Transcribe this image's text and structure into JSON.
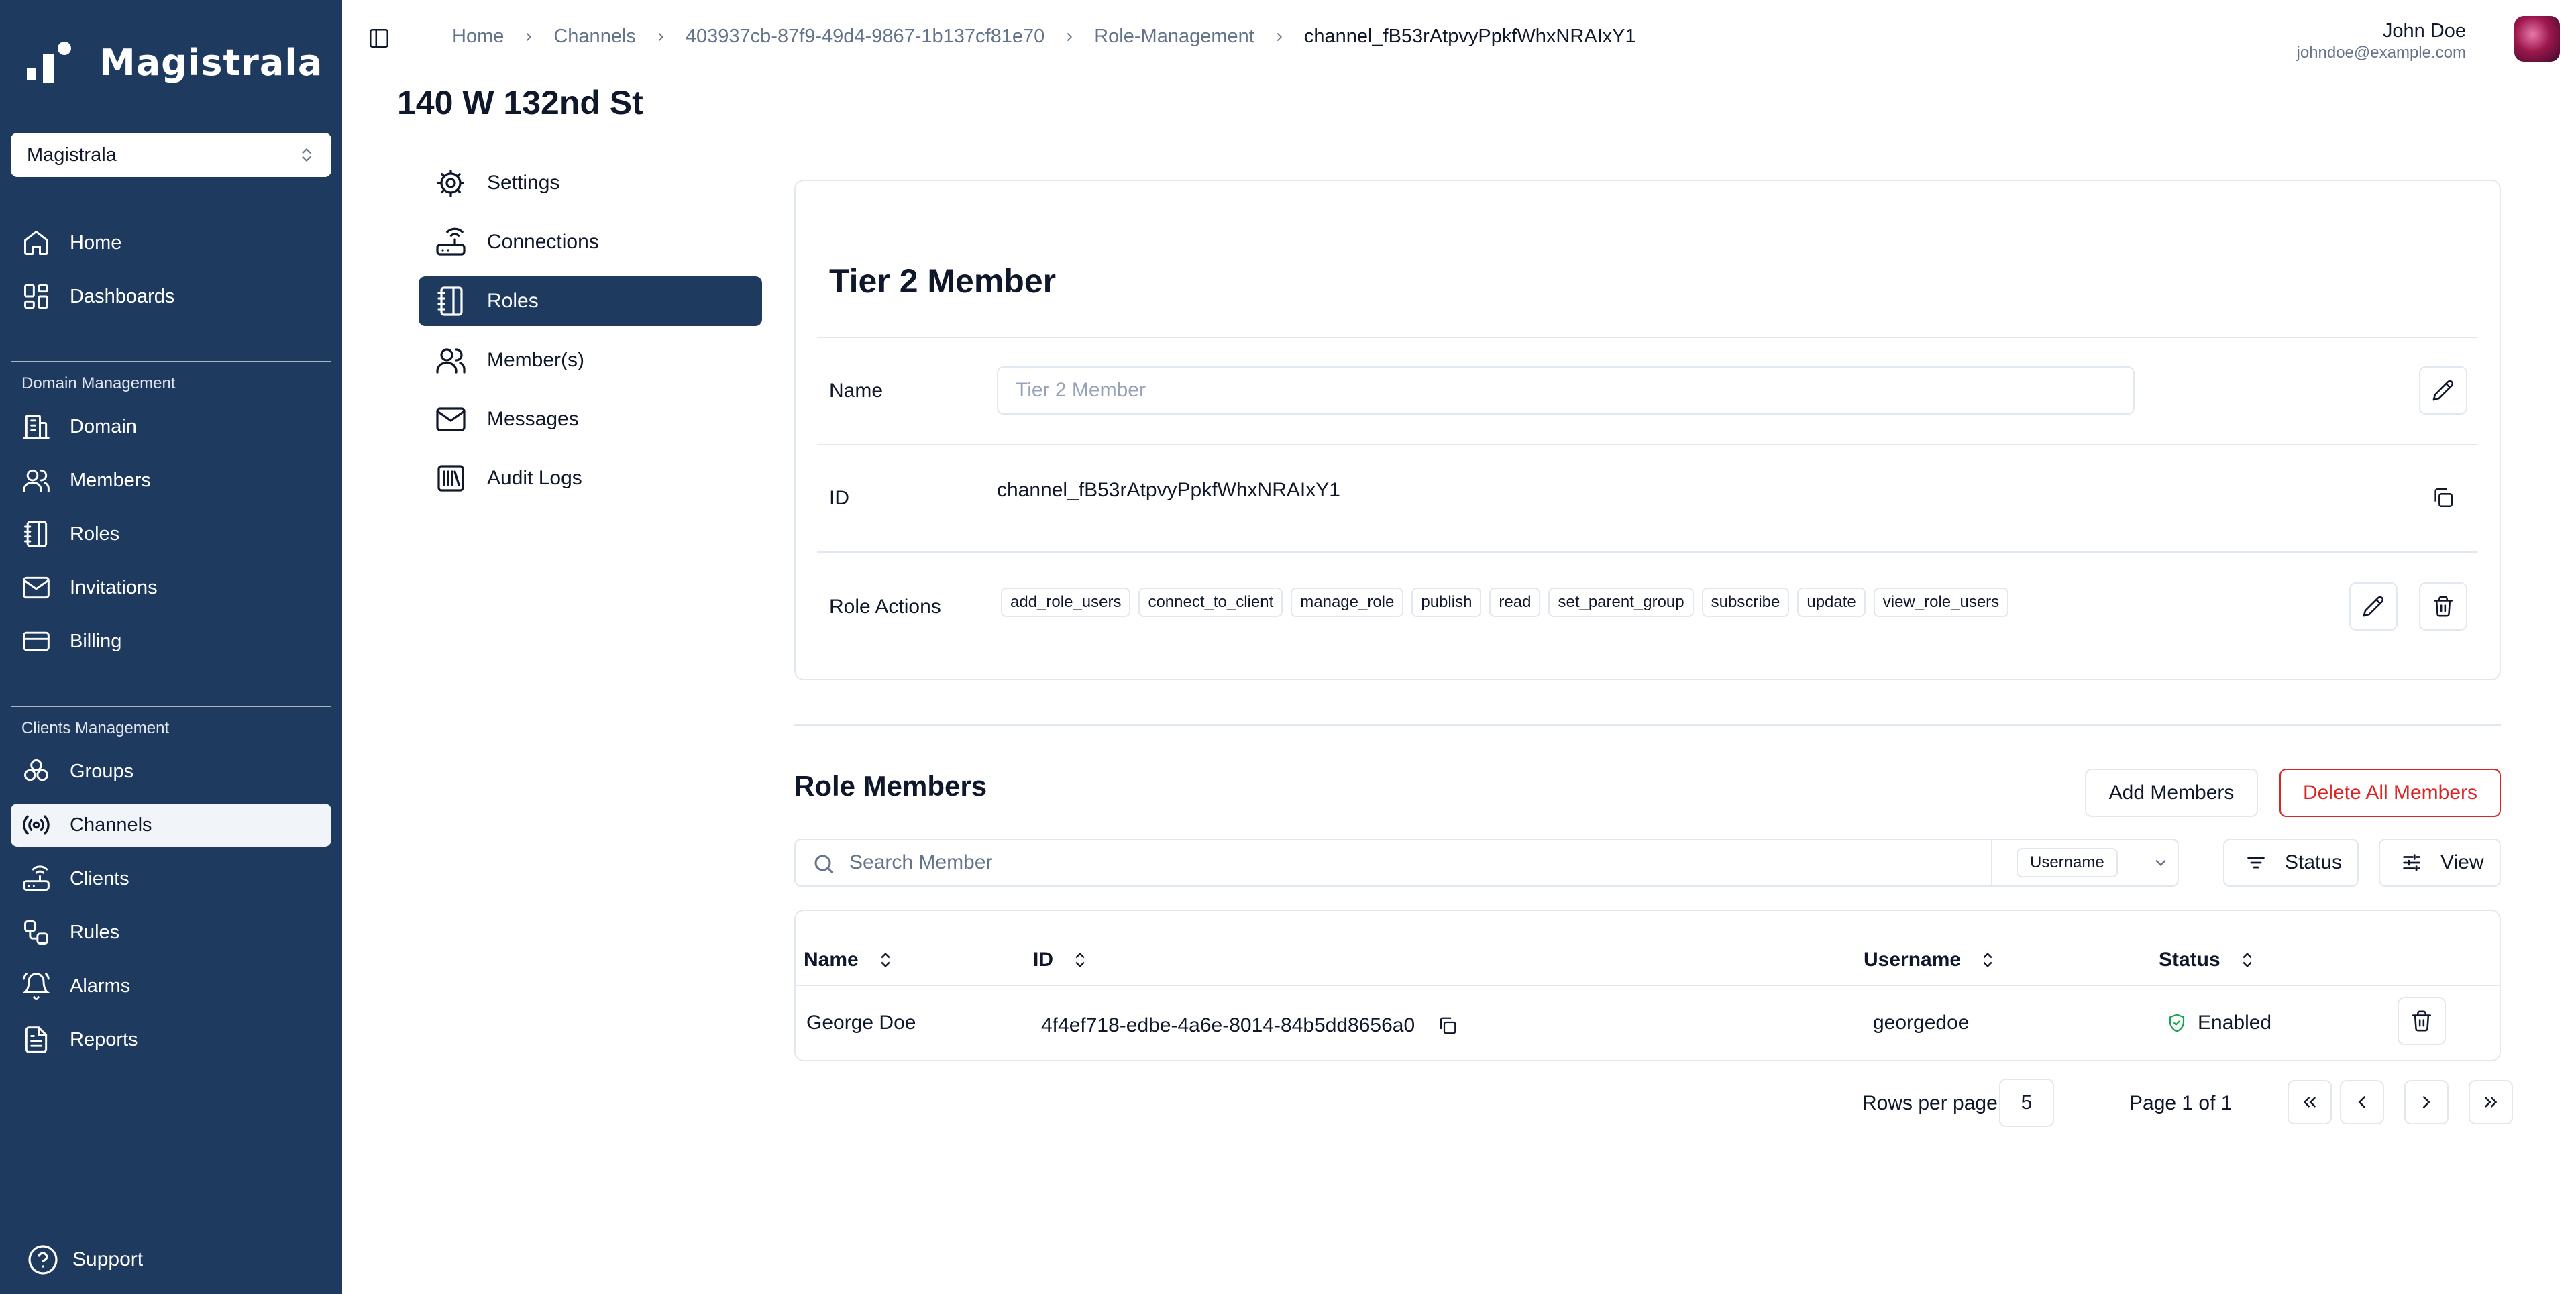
{
  "sidebar": {
    "brand": "Magistrala",
    "org_select": "Magistrala",
    "primary": [
      {
        "label": "Home",
        "icon": "home-icon"
      },
      {
        "label": "Dashboards",
        "icon": "dashboard-icon"
      }
    ],
    "domain_section": "Domain Management",
    "domain_items": [
      {
        "label": "Domain",
        "icon": "building-icon"
      },
      {
        "label": "Members",
        "icon": "users-icon"
      },
      {
        "label": "Roles",
        "icon": "notebook-icon"
      },
      {
        "label": "Invitations",
        "icon": "mail-icon"
      },
      {
        "label": "Billing",
        "icon": "credit-card-icon"
      }
    ],
    "clients_section": "Clients Management",
    "clients_items": [
      {
        "label": "Groups",
        "icon": "groups-icon"
      },
      {
        "label": "Channels",
        "icon": "radio-icon",
        "active": true
      },
      {
        "label": "Clients",
        "icon": "router-icon"
      },
      {
        "label": "Rules",
        "icon": "workflow-icon"
      },
      {
        "label": "Alarms",
        "icon": "bell-icon"
      },
      {
        "label": "Reports",
        "icon": "report-icon"
      }
    ],
    "support": "Support"
  },
  "breadcrumb": [
    "Home",
    "Channels",
    "403937cb-87f9-49d4-9867-1b137cf81e70",
    "Role-Management",
    "channel_fB53rAtpvyPpkfWhxNRAIxY1"
  ],
  "user": {
    "name": "John Doe",
    "email": "johndoe@example.com"
  },
  "page_title": "140 W 132nd St",
  "subnav": [
    {
      "label": "Settings",
      "icon": "settings-icon"
    },
    {
      "label": "Connections",
      "icon": "router-icon"
    },
    {
      "label": "Roles",
      "icon": "notebook-icon",
      "active": true
    },
    {
      "label": "Member(s)",
      "icon": "users-icon"
    },
    {
      "label": "Messages",
      "icon": "mail-icon"
    },
    {
      "label": "Audit Logs",
      "icon": "library-icon"
    }
  ],
  "role": {
    "title": "Tier 2 Member",
    "name_label": "Name",
    "name_value": "Tier 2 Member",
    "id_label": "ID",
    "id_value": "channel_fB53rAtpvyPpkfWhxNRAIxY1",
    "actions_label": "Role Actions",
    "actions": [
      "add_role_users",
      "connect_to_client",
      "manage_role",
      "publish",
      "read",
      "set_parent_group",
      "subscribe",
      "update",
      "view_role_users"
    ]
  },
  "members": {
    "title": "Role Members",
    "add_button": "Add Members",
    "delete_all_button": "Delete All Members",
    "search_placeholder": "Search Member",
    "search_field": "Username",
    "status_button": "Status",
    "view_button": "View",
    "columns": [
      "Name",
      "ID",
      "Username",
      "Status"
    ],
    "rows": [
      {
        "name": "George Doe",
        "id": "4f4ef718-edbe-4a6e-8014-84b5dd8656a0",
        "username": "georgedoe",
        "status": "Enabled"
      }
    ],
    "rows_per_page_label": "Rows per page",
    "rows_per_page": "5",
    "page_info": "Page 1 of 1"
  },
  "colors": {
    "sidebar": "#1e3a5f",
    "active": "#1e3a5f",
    "danger": "#dc2626",
    "enabled": "#16a34a"
  }
}
